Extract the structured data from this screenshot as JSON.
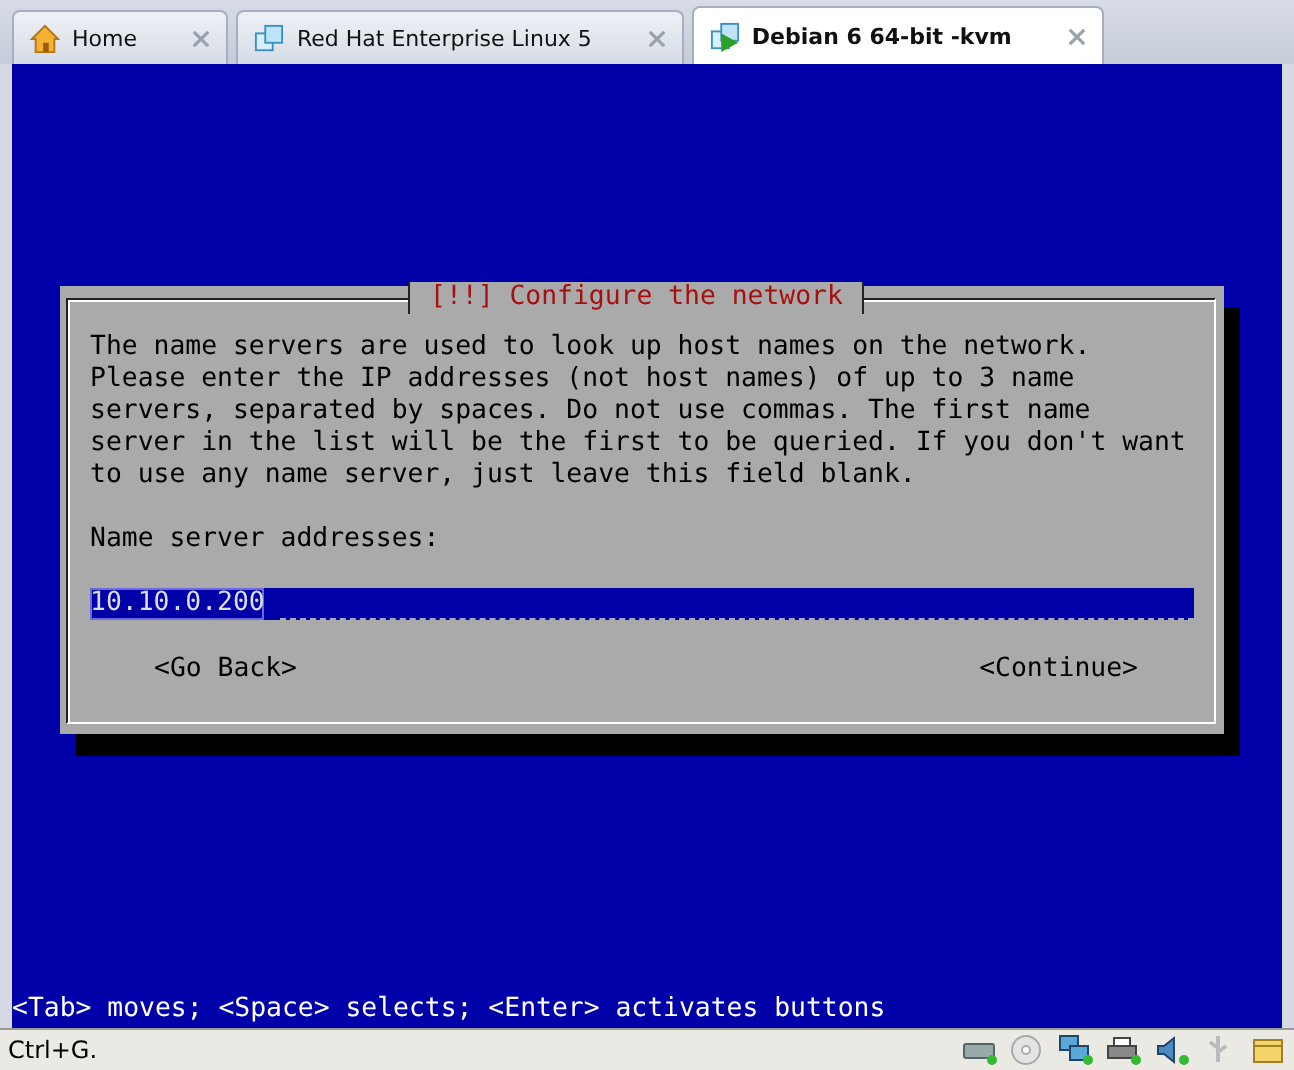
{
  "tabs": [
    {
      "label": "Home",
      "kind": "home",
      "selected": false
    },
    {
      "label": "Red Hat Enterprise Linux 5",
      "kind": "vm",
      "selected": false
    },
    {
      "label": "Debian 6 64-bit -kvm",
      "kind": "vm-running",
      "selected": true
    }
  ],
  "dialog": {
    "title": "[!!] Configure the network",
    "body": [
      "The name servers are used to look up host names on the network.",
      "Please enter the IP addresses (not host names) of up to 3 name",
      "servers, separated by spaces. Do not use commas. The first name",
      "server in the list will be the first to be queried. If you don't want",
      "to use any name server, just leave this field blank."
    ],
    "field_label": "Name server addresses:",
    "field_value": "10.10.0.200",
    "buttons": [
      "<Go Back>",
      "<Continue>"
    ]
  },
  "help_line": "<Tab> moves; <Space> selects; <Enter> activates buttons",
  "status_bar": {
    "text": "Ctrl+G."
  }
}
